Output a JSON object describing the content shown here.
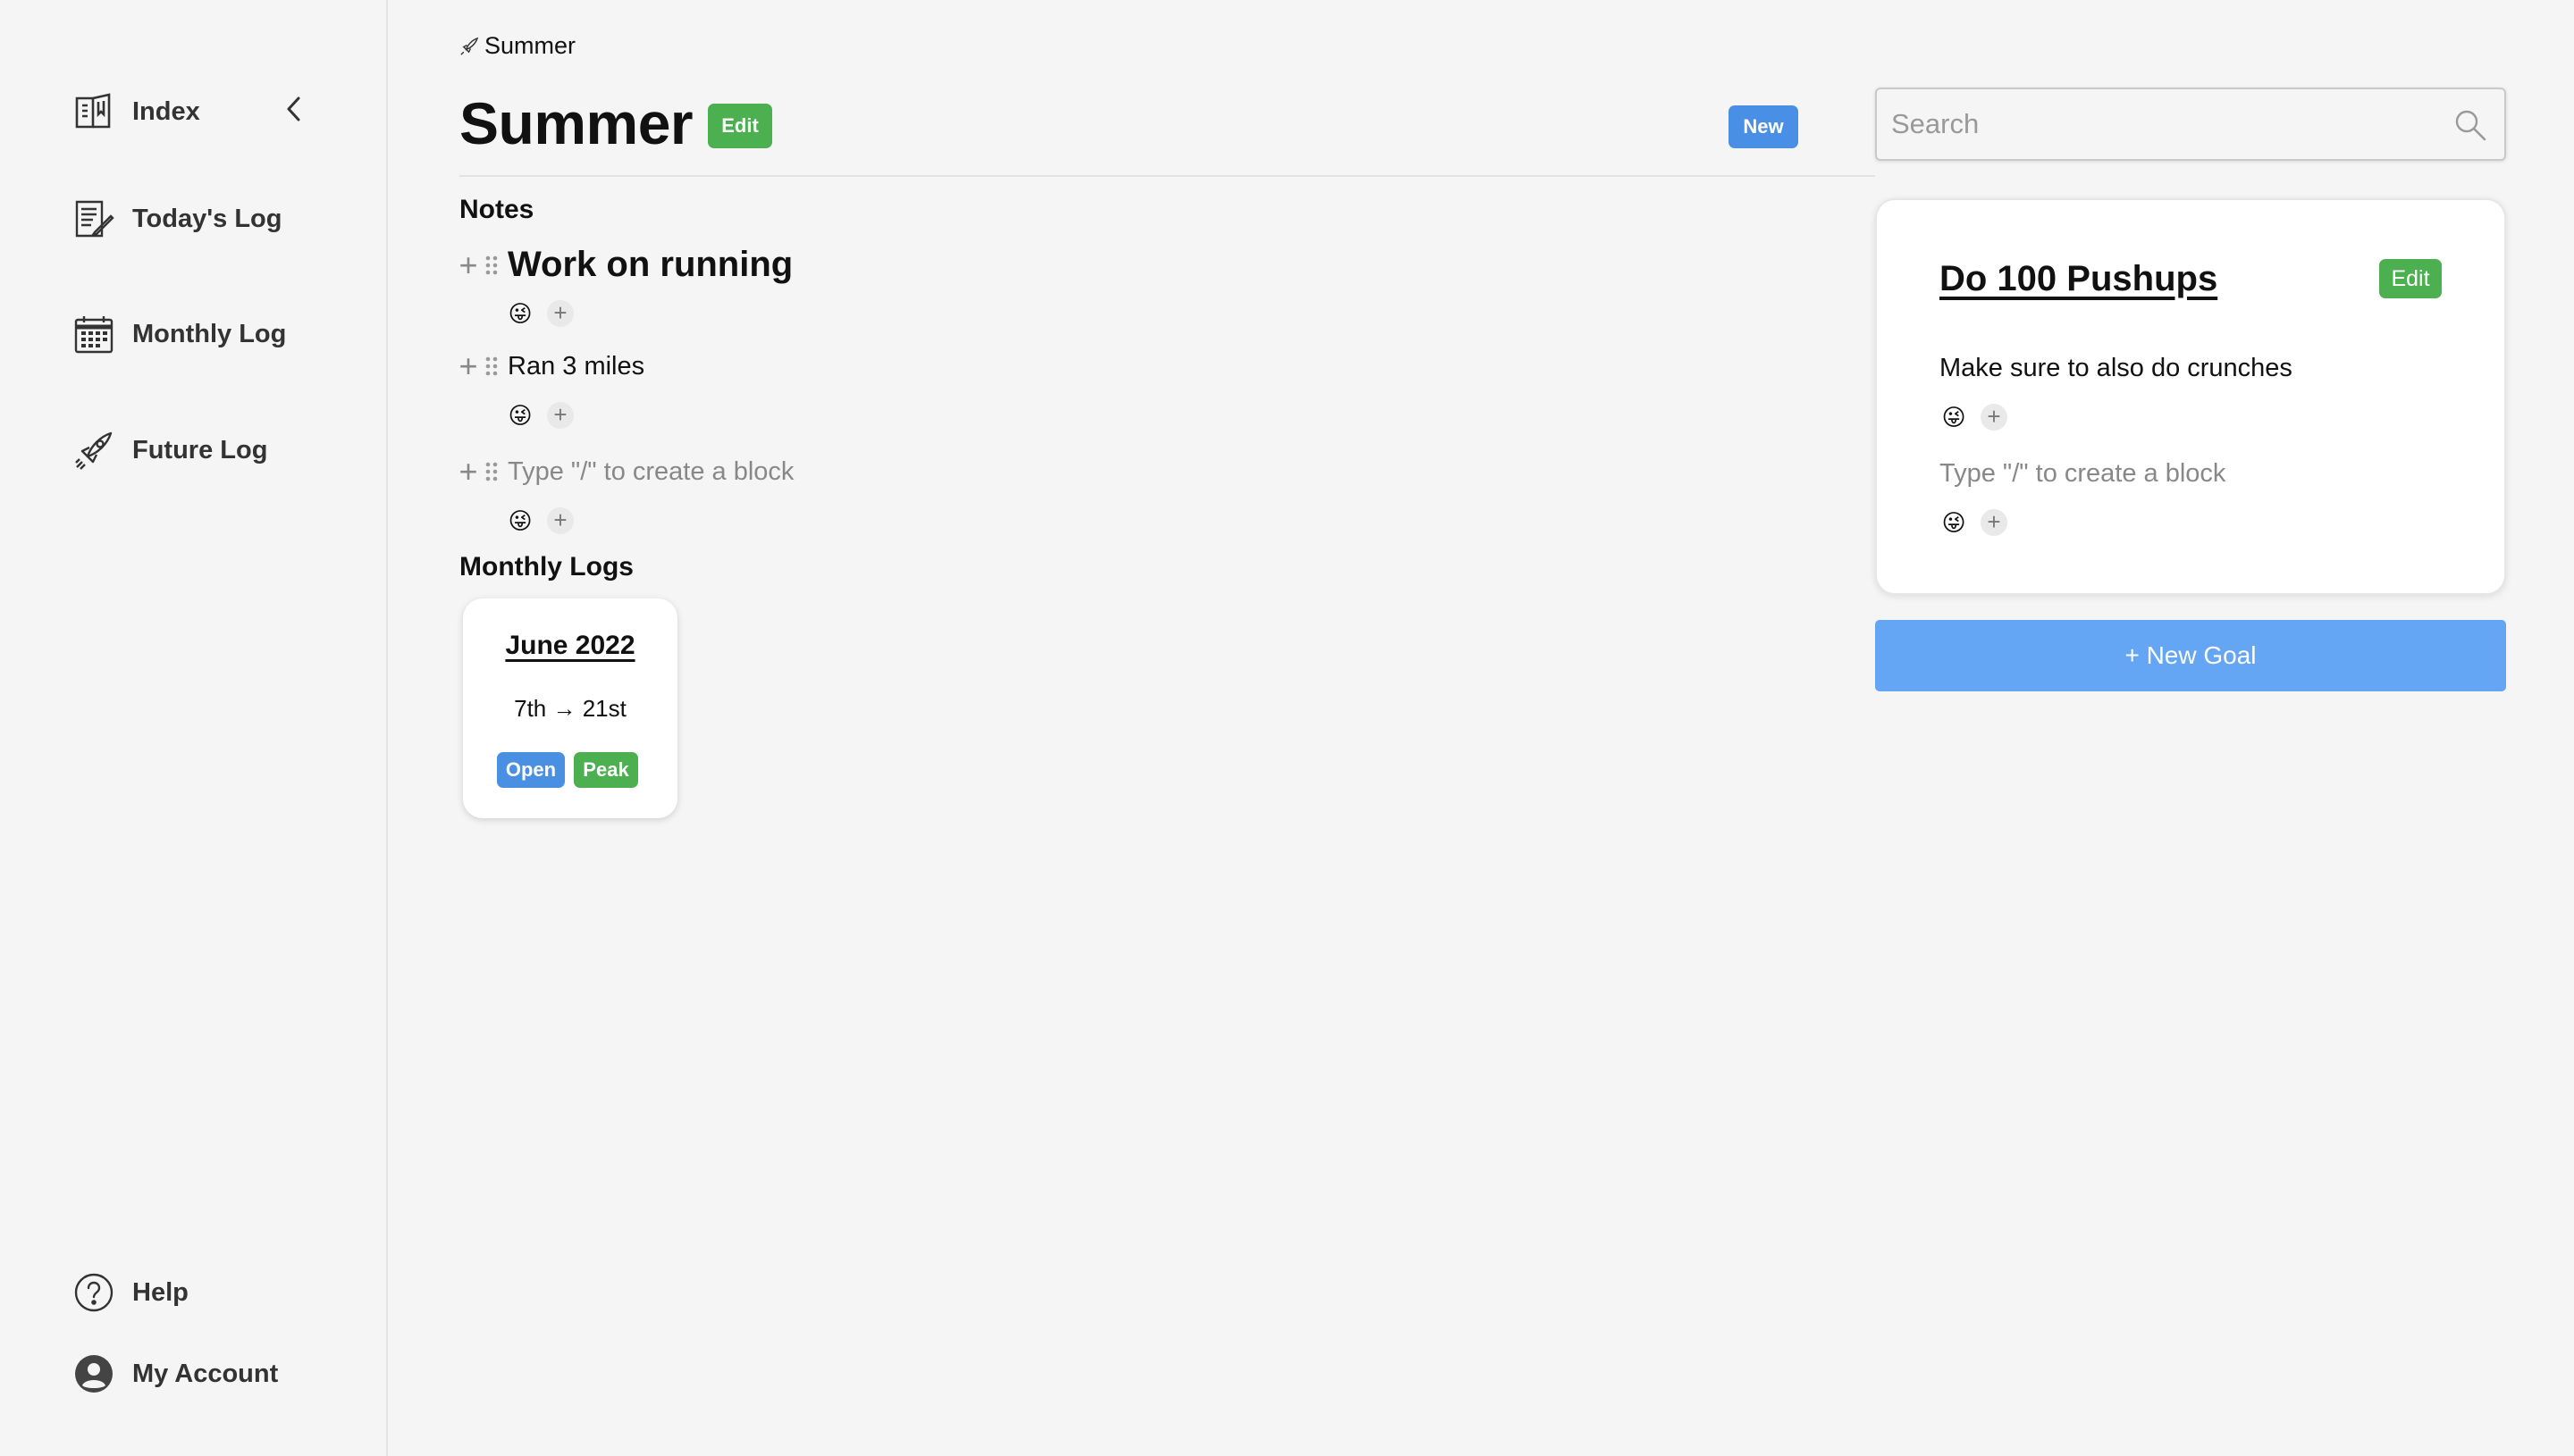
{
  "sidebar": {
    "items": [
      {
        "label": "Index",
        "icon": "book-icon"
      },
      {
        "label": "Today's Log",
        "icon": "journal-icon"
      },
      {
        "label": "Monthly Log",
        "icon": "calendar-icon"
      },
      {
        "label": "Future Log",
        "icon": "rocket-icon"
      }
    ],
    "bottom": [
      {
        "label": "Help",
        "icon": "help-icon"
      },
      {
        "label": "My Account",
        "icon": "account-icon"
      }
    ]
  },
  "page": {
    "breadcrumb": "Summer",
    "title": "Summer",
    "edit_label": "Edit",
    "new_label": "New"
  },
  "notes": {
    "heading": "Notes",
    "blocks": [
      {
        "text": "Work on running",
        "style": "heading"
      },
      {
        "text": "Ran 3 miles",
        "style": "paragraph"
      }
    ],
    "placeholder": "Type \"/\" to create a block",
    "reaction_emoji": "😜",
    "reaction_add": "+"
  },
  "monthly_logs": {
    "heading": "Monthly Logs",
    "cards": [
      {
        "title": "June 2022",
        "range": "7th → 21st",
        "open_label": "Open",
        "peak_label": "Peak"
      }
    ]
  },
  "search": {
    "placeholder": "Search"
  },
  "goal": {
    "title": "Do 100 Pushups",
    "edit_label": "Edit",
    "text": "Make sure to also do crunches",
    "placeholder": "Type \"/\" to create a block",
    "reaction_emoji": "😜",
    "reaction_add": "+"
  },
  "new_goal_label": "+ New Goal",
  "colors": {
    "green": "#4caf50",
    "blue": "#4a90e2",
    "new_goal_blue": "#64a6f4",
    "background": "#f5f5f5"
  }
}
